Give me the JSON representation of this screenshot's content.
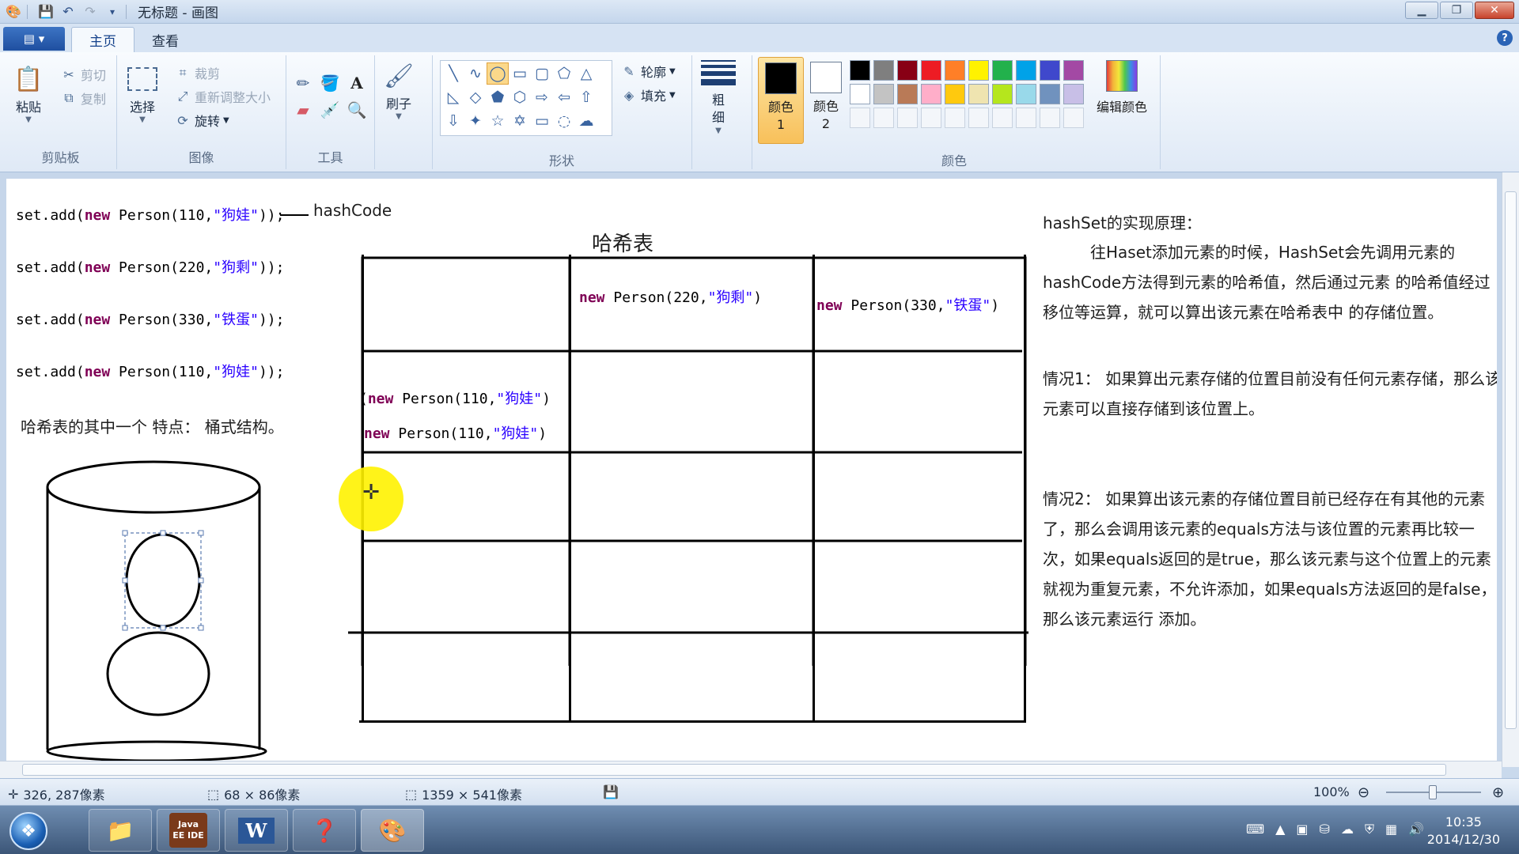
{
  "window": {
    "title": "无标题 - 画图"
  },
  "tabs": {
    "file": "▤ ▾",
    "home": "主页",
    "view": "查看"
  },
  "ribbon": {
    "clipboard": {
      "paste": "粘贴",
      "cut": "剪切",
      "copy": "复制",
      "label": "剪贴板"
    },
    "image": {
      "select": "选择",
      "crop": "裁剪",
      "resize": "重新调整大小",
      "rotate": "旋转",
      "label": "图像"
    },
    "tools": {
      "label": "工具"
    },
    "brushes": {
      "label": "刷子"
    },
    "shapes": {
      "outline": "轮廓",
      "fill": "填充",
      "label": "形状"
    },
    "size": {
      "label": "粗细"
    },
    "colors": {
      "color1": "颜色 1",
      "color2": "颜色 2",
      "edit": "编辑颜色",
      "label": "颜色",
      "palette_row1": [
        "#000000",
        "#7f7f7f",
        "#880015",
        "#ed1c24",
        "#ff7f27",
        "#fff200",
        "#22b14c",
        "#00a2e8",
        "#3f48cc",
        "#a349a4"
      ],
      "palette_row2": [
        "#ffffff",
        "#c3c3c3",
        "#b97a57",
        "#ffaec9",
        "#ffc90e",
        "#efe4b0",
        "#b5e61d",
        "#99d9ea",
        "#7092be",
        "#c8bfe7"
      ]
    }
  },
  "canvas": {
    "code_lines": [
      {
        "prefix": "set.add(",
        "kw": "new",
        "mid": " Person(110,",
        "q1": "\"",
        "name": "狗娃",
        "q2": "\"",
        "end": ")); "
      },
      {
        "prefix": "set.add(",
        "kw": "new",
        "mid": " Person(220,",
        "q1": "\"",
        "name": "狗剩",
        "q2": "\"",
        "end": "));"
      },
      {
        "prefix": "set.add(",
        "kw": "new",
        "mid": " Person(330,",
        "q1": "\"",
        "name": "铁蛋",
        "q2": "\"",
        "end": "));"
      },
      {
        "prefix": "set.add(",
        "kw": "new",
        "mid": " Person(110,",
        "q1": "\"",
        "name": "狗娃",
        "q2": "\"",
        "end": "));"
      }
    ],
    "hashcode_label": "hashCode",
    "table_title": "哈希表",
    "bucket_note": "哈希表的其中一个 特点： 桶式结构。",
    "cells": {
      "c12": {
        "kw": "new",
        "mid": " Person(220,",
        "q1": "\"",
        "name": "狗剩",
        "q2": "\"",
        "end": ")"
      },
      "c13": {
        "kw": "new",
        "mid": " Person(330,",
        "q1": "\"",
        "name": "铁蛋",
        "q2": "\"",
        "end": ")"
      },
      "c21a": {
        "kw": "new",
        "mid": " Person(110,",
        "q1": "\"",
        "name": "狗娃",
        "q2": "\"",
        "end": ")"
      },
      "c21b": {
        "kw": "new",
        "mid": " Person(110,",
        "q1": "\"",
        "name": "狗娃",
        "q2": "\"",
        "end": ")"
      }
    },
    "explain": {
      "title": "hashSet的实现原理：",
      "p1": "往Haset添加元素的时候，HashSet会先调用元素的hashCode方法得到元素的哈希值，然后通过元素 的哈希值经过移位等运算，就可以算出该元素在哈希表中 的存储位置。",
      "p2": "情况1： 如果算出元素存储的位置目前没有任何元素存储，那么该元素可以直接存储到该位置上。",
      "p3": "情况2： 如果算出该元素的存储位置目前已经存在有其他的元素了，那么会调用该元素的equals方法与该位置的元素再比较一次，如果equals返回的是true，那么该元素与这个位置上的元素就视为重复元素，不允许添加，如果equals方法返回的是false，那么该元素运行 添加。"
    }
  },
  "status": {
    "cursor": "326, 287像素",
    "selection": "68 × 86像素",
    "canvas_size": "1359 × 541像素",
    "zoom": "100%"
  },
  "taskbar": {
    "time": "10:35",
    "date": "2014/12/30",
    "javaee_label": "Java EE IDE"
  }
}
